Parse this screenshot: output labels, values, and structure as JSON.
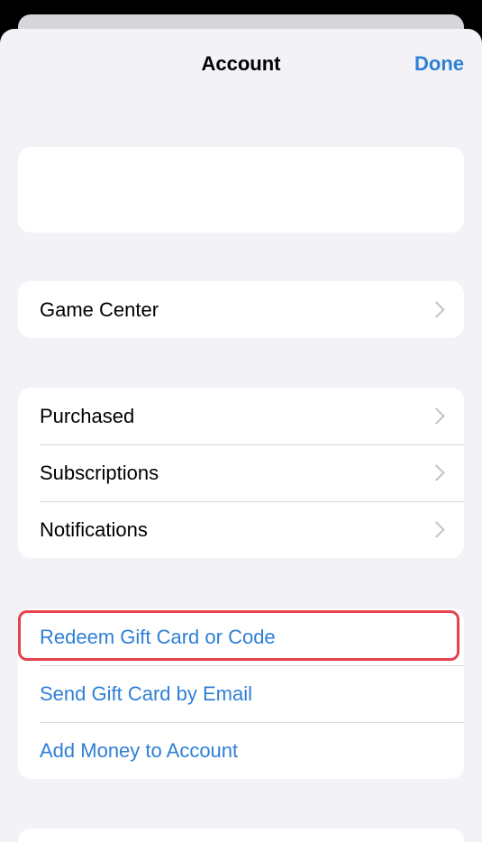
{
  "header": {
    "title": "Account",
    "done_label": "Done"
  },
  "profile_card": {},
  "game_center": {
    "label": "Game Center"
  },
  "account_items": [
    {
      "label": "Purchased"
    },
    {
      "label": "Subscriptions"
    },
    {
      "label": "Notifications"
    }
  ],
  "money_items": [
    {
      "label": "Redeem Gift Card or Code"
    },
    {
      "label": "Send Gift Card by Email"
    },
    {
      "label": "Add Money to Account"
    }
  ],
  "colors": {
    "accent": "#2f7fd5",
    "highlight": "#e5414f",
    "background": "#f2f2f7"
  },
  "icons": {
    "disclosure": "chevron-right-icon"
  }
}
